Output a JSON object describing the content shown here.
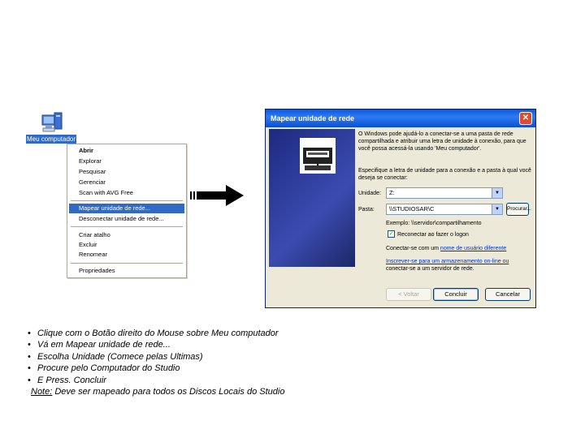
{
  "desktop": {
    "icon_label": "Meu computador",
    "icon": "my-computer-icon"
  },
  "context_menu": {
    "items": [
      {
        "label": "Abrir"
      },
      {
        "label": "Explorar"
      },
      {
        "label": "Pesquisar"
      },
      {
        "label": "Gerenciar"
      },
      {
        "label": "Scan with AVG Free"
      },
      {
        "label": "Mapear unidade de rede..."
      },
      {
        "label": "Desconectar unidade de rede..."
      },
      {
        "label": "Criar atalho"
      },
      {
        "label": "Excluir"
      },
      {
        "label": "Renomear"
      },
      {
        "label": "Propriedades"
      }
    ]
  },
  "dialog": {
    "title": "Mapear unidade de rede",
    "intro": "O Windows pode ajudá-lo a conectar-se a uma pasta de rede compartilhada e atribuir uma letra de unidade à conexão, para que você possa acessá-la usando 'Meu computador'.",
    "instruction": "Especifique a letra de unidade para a conexão e a pasta à qual você deseja se conectar:",
    "drive_label": "Unidade:",
    "drive_value": "Z:",
    "folder_label": "Pasta:",
    "folder_value": "\\\\STUDIOSAR\\C",
    "browse_button": "Procurar...",
    "example": "Exemplo: \\\\servidor\\compartilhamento",
    "reconnect_label": "Reconectar ao fazer o logon",
    "connect_other_prefix": "Conectar-se com um ",
    "connect_other_link": "nome de usuário diferente",
    "signup_link": "Inscrever-se para um armazenamento on-line ou",
    "signup_text": "conectar-se a um servidor de rede.",
    "back_button": "< Voltar",
    "finish_button": "Concluir",
    "cancel_button": "Cancelar",
    "close_glyph": "✕"
  },
  "instructions": {
    "bullet": "•",
    "steps": [
      "Clique com o Botão direito do Mouse sobre Meu computador",
      "Vá em Mapear unidade de rede...",
      "Escolha Unidade (Comece pelas Ultimas)",
      "Procure pelo Computador do Studio",
      "E Press. Concluir"
    ],
    "note_label": "Note:",
    "note_text": " Deve ser mapeado para todos os Discos Locais do Studio"
  }
}
